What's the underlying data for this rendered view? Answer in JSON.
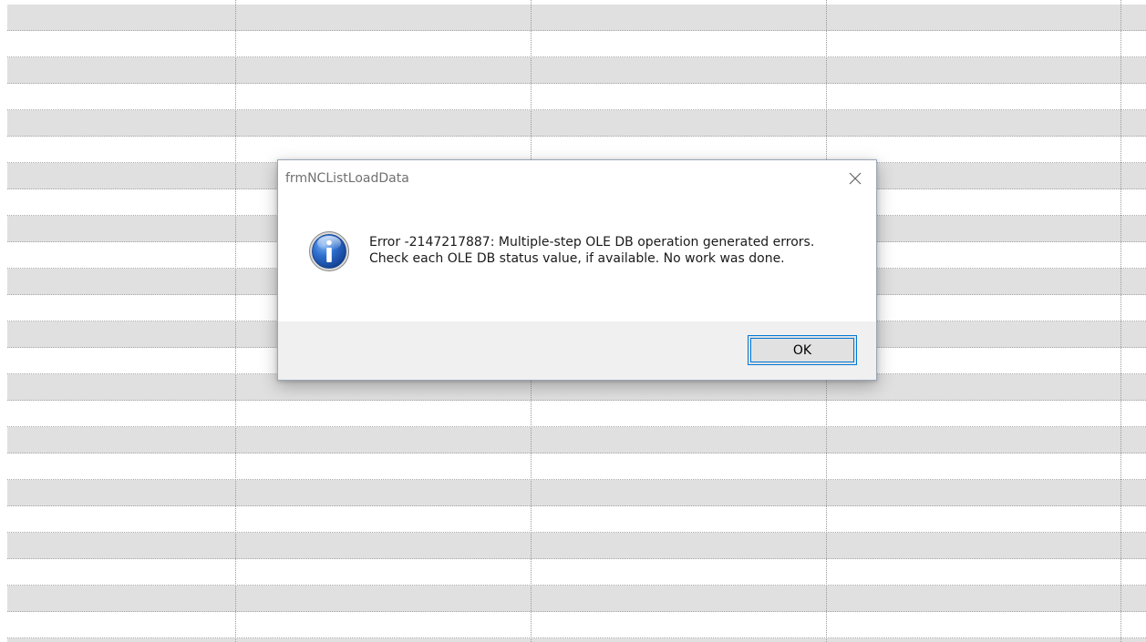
{
  "dialog": {
    "title": "frmNCListLoadData",
    "message": "Error -2147217887: Multiple-step OLE DB operation generated errors. Check each OLE DB status value, if available. No work was done.",
    "ok_label": "OK",
    "icon": "information-icon",
    "close_icon": "close-icon"
  },
  "colors": {
    "accent": "#0078d7",
    "row_shaded": "#e0e0e0",
    "row_plain": "#ffffff",
    "footer_bg": "#f0f0f0",
    "info_icon_blue": "#1f5fbf"
  }
}
